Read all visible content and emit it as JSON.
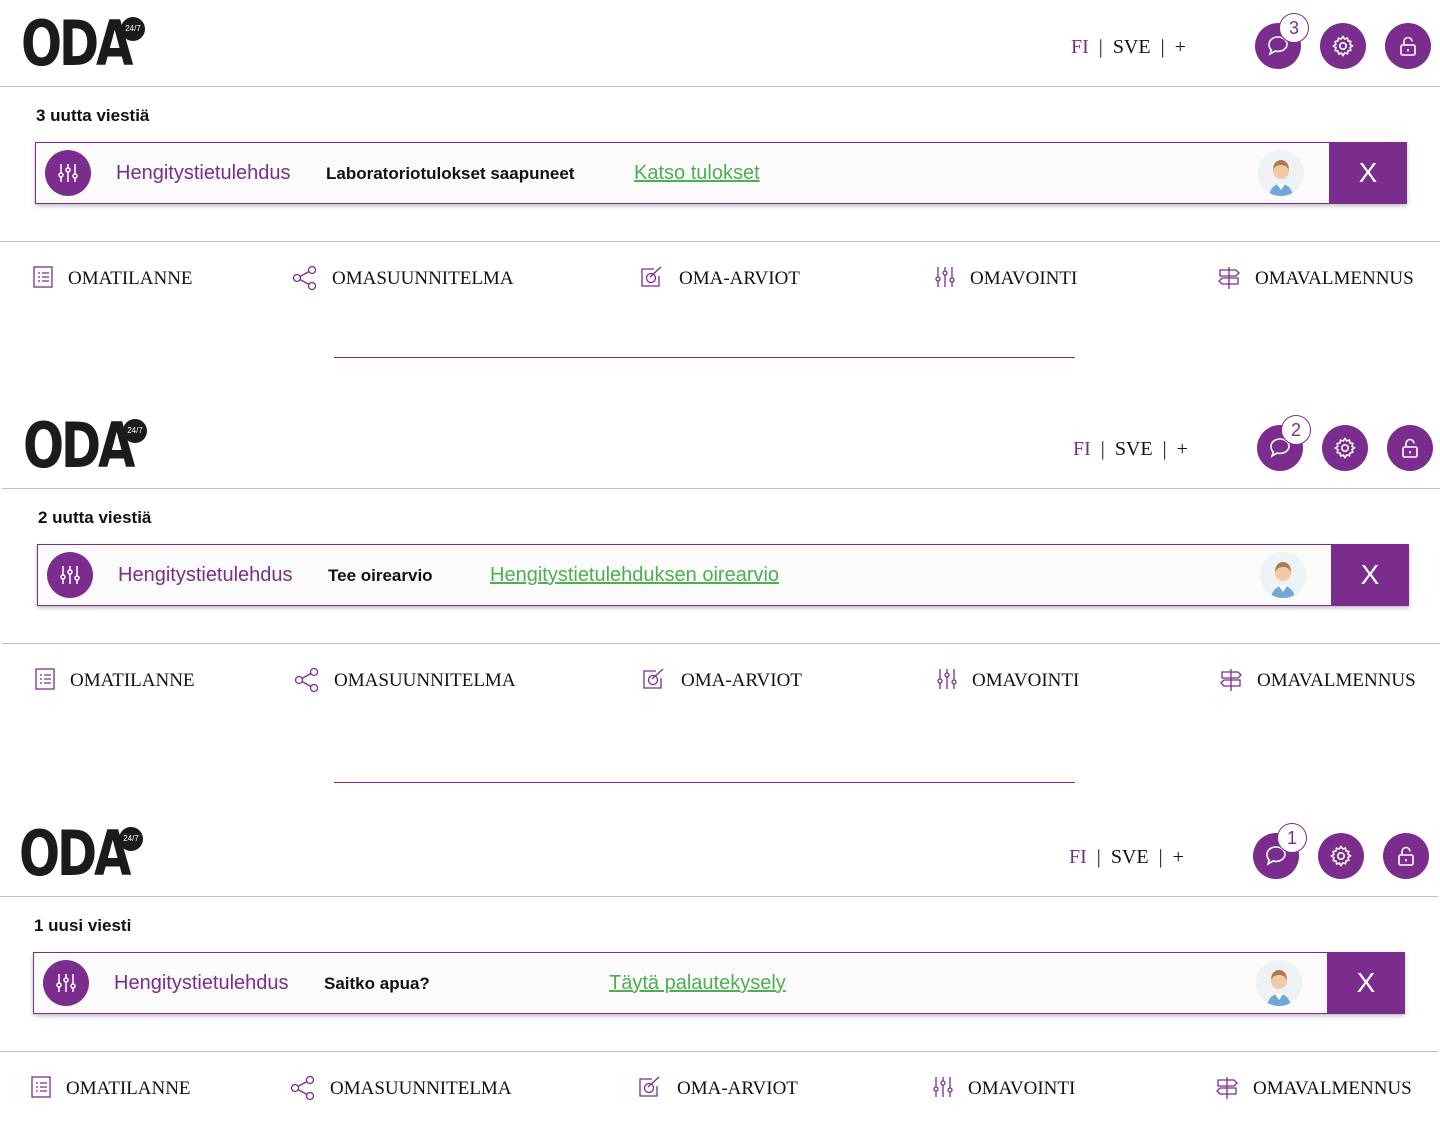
{
  "brand": {
    "logo": "ODA",
    "logo_badge": "24/7",
    "accent": "#7b2d8e",
    "link_color": "#4caf50"
  },
  "header": {
    "lang_fi": "FI",
    "lang_sve": "SVE",
    "lang_more": "+",
    "sep": "|",
    "icons": [
      "chat-icon",
      "gear-icon",
      "unlock-icon"
    ]
  },
  "nav": {
    "items": [
      {
        "label": "OMATILANNE",
        "icon": "list-icon"
      },
      {
        "label": "OMASUUNNITELMA",
        "icon": "share-icon"
      },
      {
        "label": "OMA-ARVIOT",
        "icon": "check-square-icon"
      },
      {
        "label": "OMAVOINTI",
        "icon": "sliders-icon"
      },
      {
        "label": "OMAVALMENNUS",
        "icon": "signpost-icon"
      }
    ]
  },
  "panels": [
    {
      "badge": "3",
      "count_text": "3 uutta viestiä",
      "notification": {
        "category": "Hengitystietulehdus",
        "title": "Laboratoriotulokset saapuneet",
        "link": "Katso tulokset",
        "close": "X"
      }
    },
    {
      "badge": "2",
      "count_text": "2 uutta viestiä",
      "notification": {
        "category": "Hengitystietulehdus",
        "title": "Tee oirearvio",
        "link": "Hengitystietulehduksen oirearvio",
        "close": "X"
      }
    },
    {
      "badge": "1",
      "count_text": "1 uusi viesti",
      "notification": {
        "category": "Hengitystietulehdus",
        "title": "Saitko apua?",
        "link": "Täytä palautekysely",
        "close": "X"
      }
    }
  ]
}
